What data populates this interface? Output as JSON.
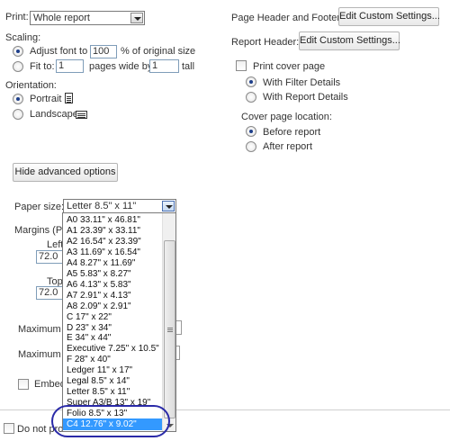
{
  "print": {
    "label": "Print:",
    "value": "Whole report"
  },
  "scaling": {
    "label": "Scaling:",
    "adjust_label": "Adjust font to",
    "adjust_value": "100",
    "adjust_suffix": "% of original size",
    "fit_label": "Fit to:",
    "fit_wide_value": "1",
    "fit_mid": "pages wide by",
    "fit_tall_value": "1",
    "fit_suffix": "tall"
  },
  "orientation": {
    "label": "Orientation:",
    "portrait": "Portrait",
    "landscape": "Landscape"
  },
  "right_panel": {
    "header_footer_label": "Page Header and Footer:",
    "header_footer_button": "Edit Custom Settings...",
    "report_header_label": "Report Header:",
    "report_header_button": "Edit Custom Settings...",
    "cover_page_label": "Print cover page",
    "with_filter": "With Filter Details",
    "with_report": "With Report Details",
    "cover_location_label": "Cover page location:",
    "before_report": "Before report",
    "after_report": "After report"
  },
  "hide_advanced_button": "Hide advanced options",
  "paper_size": {
    "label": "Paper size:",
    "value": "Letter 8.5\" x 11\"",
    "options": [
      "A0 33.11\" x 46.81\"",
      "A1 23.39\" x 33.11\"",
      "A2 16.54\" x 23.39\"",
      "A3 11.69\" x 16.54\"",
      "A4 8.27\" x 11.69\"",
      "A5 5.83\" x 8.27\"",
      "A6 4.13\" x 5.83\"",
      "A7 2.91\" x 4.13\"",
      "A8 2.09\" x 2.91\"",
      "C 17\" x 22\"",
      "D 23\" x 34\"",
      "E 34\" x 44\"",
      "Executive 7.25\" x 10.5\"",
      "F 28\" x 40\"",
      "Ledger 11\" x 17\"",
      "Legal 8.5\" x 14\"",
      "Letter 8.5\" x 11\"",
      "Super A3/B 13\" x 19\"",
      "Folio 8.5\" x 13\"",
      "C4 12.76\" x 9.02\""
    ],
    "selected_option": "C4 12.76\" x 9.02\""
  },
  "margins": {
    "label": "Margins (Pix",
    "left_label": "Left",
    "left_value": "72.0",
    "top_label": "Top",
    "top_value": "72.0"
  },
  "maximum_1_label": "Maximum h",
  "maximum_2_label": "Maximum f",
  "embed_label": "Embed",
  "bottom_check_label": "Do not pro"
}
